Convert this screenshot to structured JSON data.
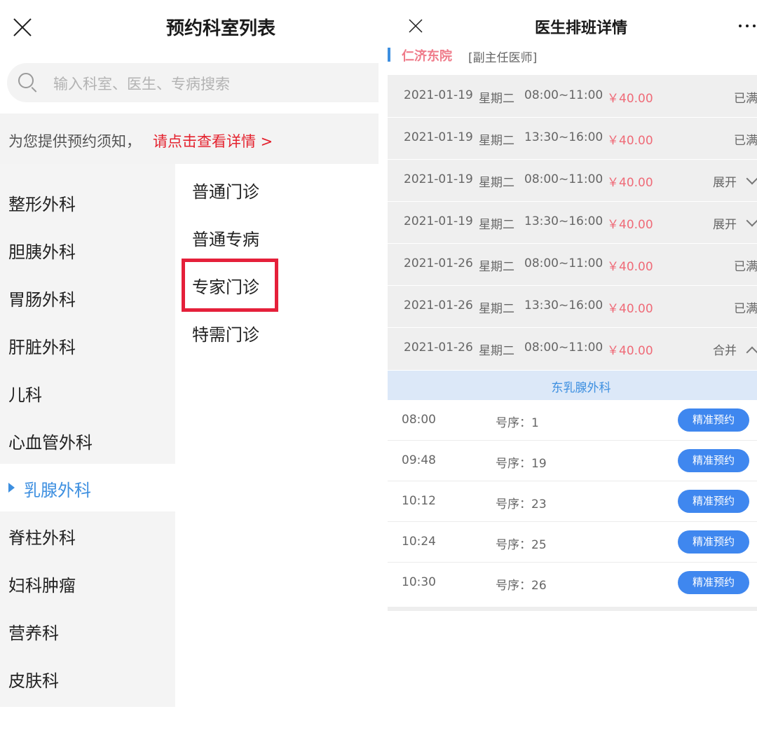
{
  "left": {
    "title": "预约科室列表",
    "search_placeholder": "输入科室、医生、专病搜索",
    "notice_text": "为您提供预约须知，",
    "notice_link": "请点击查看详情 >",
    "departments": [
      {
        "label": "整形外科",
        "active": false
      },
      {
        "label": "胆胰外科",
        "active": false
      },
      {
        "label": "胃肠外科",
        "active": false
      },
      {
        "label": "肝脏外科",
        "active": false
      },
      {
        "label": "儿科",
        "active": false
      },
      {
        "label": "心血管外科",
        "active": false
      },
      {
        "label": "乳腺外科",
        "active": true
      },
      {
        "label": "脊柱外科",
        "active": false
      },
      {
        "label": "妇科肿瘤",
        "active": false
      },
      {
        "label": "营养科",
        "active": false
      },
      {
        "label": "皮肤科",
        "active": false
      }
    ],
    "sub_items": [
      "普通门诊",
      "普通专病",
      "专家门诊",
      "特需门诊"
    ],
    "highlighted_sub": "专家门诊",
    "highlight_color": "#e5203a"
  },
  "right": {
    "title": "医生排班详情",
    "doctor": {
      "hospital": "仁济东院",
      "title": "[副主任医师]"
    },
    "schedule": [
      {
        "date": "2021-01-19",
        "weekday": "星期二",
        "time": "08:00~11:00",
        "price": "￥40.00",
        "status": "已满"
      },
      {
        "date": "2021-01-19",
        "weekday": "星期二",
        "time": "13:30~16:00",
        "price": "￥40.00",
        "status": "已满"
      },
      {
        "date": "2021-01-19",
        "weekday": "星期二",
        "time": "08:00~11:00",
        "price": "￥40.00",
        "status": "展开"
      },
      {
        "date": "2021-01-19",
        "weekday": "星期二",
        "time": "13:30~16:00",
        "price": "￥40.00",
        "status": "展开"
      },
      {
        "date": "2021-01-26",
        "weekday": "星期二",
        "time": "08:00~11:00",
        "price": "￥40.00",
        "status": "已满"
      },
      {
        "date": "2021-01-26",
        "weekday": "星期二",
        "time": "13:30~16:00",
        "price": "￥40.00",
        "status": "已满"
      },
      {
        "date": "2021-01-26",
        "weekday": "星期二",
        "time": "08:00~11:00",
        "price": "￥40.00",
        "status": "合并"
      }
    ],
    "section_label": "东乳腺外科",
    "slots": [
      {
        "time": "08:00",
        "number": "号序：1",
        "button": "精准预约"
      },
      {
        "time": "09:48",
        "number": "号序：19",
        "button": "精准预约"
      },
      {
        "time": "10:12",
        "number": "号序：23",
        "button": "精准预约"
      },
      {
        "time": "10:24",
        "number": "号序：25",
        "button": "精准预约"
      },
      {
        "time": "10:30",
        "number": "号序：26",
        "button": "精准预约"
      }
    ],
    "colors": {
      "accent": "#3d8fe0",
      "button": "#3f87ef",
      "price": "#ef6b78"
    }
  }
}
